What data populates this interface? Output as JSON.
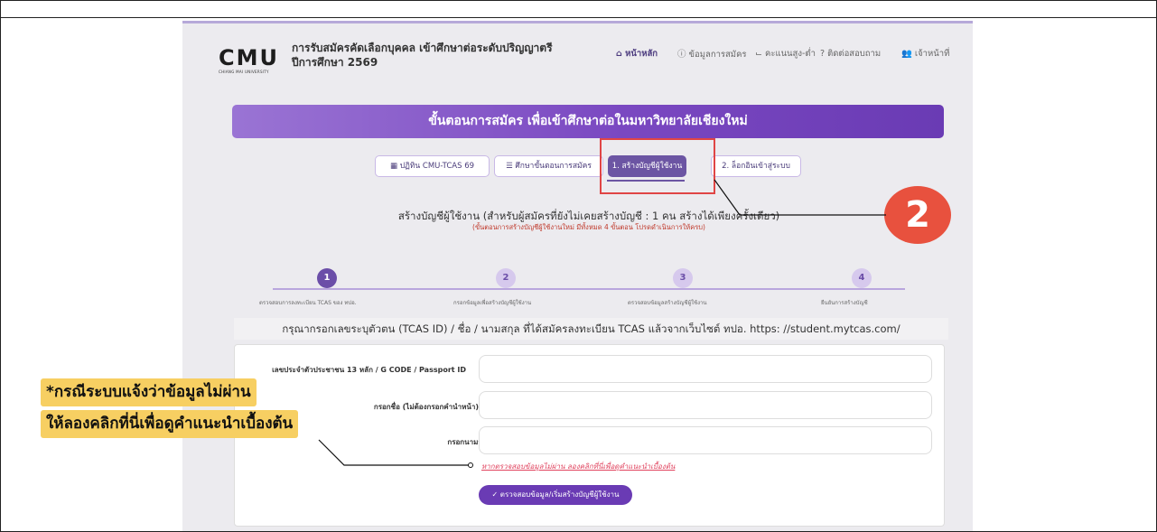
{
  "header": {
    "logo_main": "CMU",
    "logo_sub": "CHIANG MAI UNIVERSITY",
    "title_line1": "การรับสมัครคัดเลือกบุคคล เข้าศึกษาต่อระดับปริญญาตรี",
    "title_line2": "ปีการศึกษา 2569",
    "nav": [
      {
        "label": "หน้าหลัก",
        "icon": "home-icon",
        "active": true
      },
      {
        "label": "ข้อมูลการสมัคร",
        "icon": "info-icon",
        "active": false
      },
      {
        "label": "คะแนนสูง-ต่ำ",
        "icon": "chart-icon",
        "active": false
      },
      {
        "label": "ติดต่อสอบถาม",
        "icon": "question-icon",
        "active": false
      },
      {
        "label": "เจ้าหน้าที่",
        "icon": "users-icon",
        "active": false
      }
    ]
  },
  "banner": "ขั้นตอนการสมัคร เพื่อเข้าศึกษาต่อในมหาวิทยาลัยเชียงใหม่",
  "tabs": [
    {
      "label": "ปฏิทิน CMU-TCAS 69",
      "icon": "calendar-icon"
    },
    {
      "label": "ศึกษาขั้นตอนการสมัคร",
      "icon": "list-icon"
    },
    {
      "label": "1. สร้างบัญชีผู้ใช้งาน",
      "icon": ""
    },
    {
      "label": "2. ล็อกอินเข้าสู่ระบบ",
      "icon": ""
    }
  ],
  "section": {
    "title": "สร้างบัญชีผู้ใช้งาน (สำหรับผู้สมัครที่ยังไม่เคยสร้างบัญชี : 1 คน สร้างได้เพียงครั้งเดียว)",
    "note": "(ขั้นตอนการสร้างบัญชีผู้ใช้งานใหม่ มีทั้งหมด 4 ขั้นตอน โปรดดำเนินการให้ครบ)"
  },
  "steps": [
    {
      "number": "1",
      "label": "ตรวจสอบการลงทะเบียน TCAS ของ ทปอ."
    },
    {
      "number": "2",
      "label": "กรอกข้อมูลเพื่อสร้างบัญชีผู้ใช้งาน"
    },
    {
      "number": "3",
      "label": "ตรวจสอบข้อมูลสร้างบัญชีผู้ใช้งาน"
    },
    {
      "number": "4",
      "label": "ยืนยันการสร้างบัญชี"
    }
  ],
  "instruction": "กรุณากรอกเลขระบุตัวตน (TCAS ID) / ชื่อ / นามสกุล ที่ได้สมัครลงทะเบียน TCAS แล้วจากเว็บไซต์ ทปอ. https: //student.mytcas.com/",
  "form": {
    "id_label": "เลขประจำตัวประชาชน 13 หลัก / G CODE / Passport ID",
    "id_value": "",
    "firstname_label": "กรอกชื่อ (ไม่ต้องกรอกคำนำหน้า)",
    "firstname_value": "",
    "lastname_label": "กรอกนามสกุล",
    "lastname_value": "",
    "help_link": "หากตรวจสอบข้อมูลไม่ผ่าน ลองคลิกที่นี่เพื่อดูคำแนะนำเบื้องต้น",
    "submit": "ตรวจสอบข้อมูล/เริ่มสร้างบัญชีผู้ใช้งาน"
  },
  "annotations": {
    "badge": "2",
    "note_line1": "*กรณีระบบแจ้งว่าข้อมูลไม่ผ่าน",
    "note_line2": "ให้ลองคลิกที่นี่เพื่อดูคำแนะนำเบื้องต้น",
    "highlight_color": "#f7cf62",
    "badge_color": "#e8513e",
    "box_color": "#e04545"
  },
  "colors": {
    "brand_purple": "#6a3bb4",
    "link_red": "#e0405c"
  }
}
